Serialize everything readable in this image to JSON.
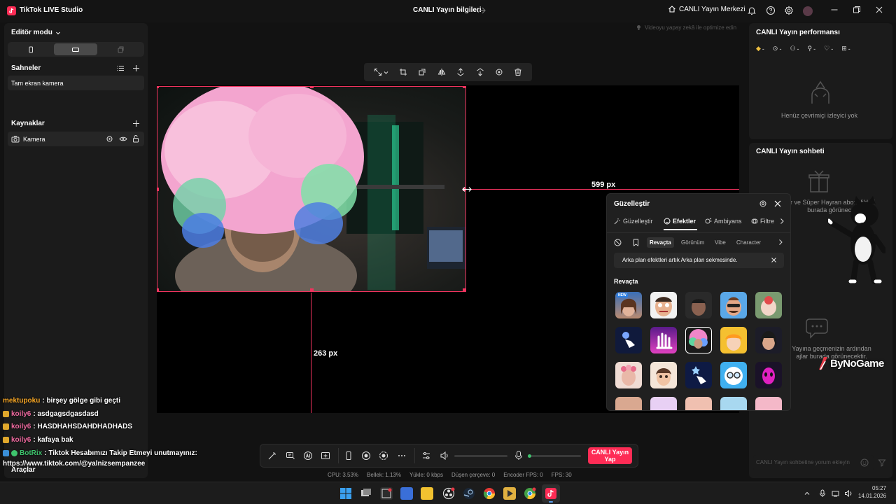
{
  "titlebar": {
    "app_title": "TikTok LIVE Studio",
    "center_title": "CANLI Yayın bilgileri",
    "live_center": "CANLI Yayın Merkezi"
  },
  "left": {
    "editor_mode": "Editör modu",
    "scenes_title": "Sahneler",
    "scene_item": "Tam ekran kamera",
    "sources_title": "Kaynaklar",
    "source_item": "Kamera",
    "tools": "Araçlar"
  },
  "chat_overlay": [
    {
      "user": "mektupoku",
      "text": ": birşey gölge gibi geçti"
    },
    {
      "user": "koily6",
      "text": ": asdgagsdgasdasd"
    },
    {
      "user": "koily6",
      "text": ": HASDHAHSDAHDHADHADS"
    },
    {
      "user": "koily6",
      "text": ": kafaya bak"
    },
    {
      "user": "BotRix",
      "text": ": Tiktok Hesabımızı Takip Etmeyi unutmayınız:"
    }
  ],
  "chat_link": "https://www.tiktok.com/@yalnizsempanzee",
  "canvas": {
    "optimize_hint": "Videoyu yapay zekâ ile optimize edin",
    "measure_right": "599 px",
    "measure_bottom": "263 px"
  },
  "bottom": {
    "go_live": "CANLI Yayın Yap",
    "stats": [
      "CPU: 3.53%",
      "Bellek: 1.13%",
      "Yükle: 0 kbps",
      "Düşen çerçeve: 0",
      "Encoder FPS: 0",
      "FPS: 30"
    ]
  },
  "right": {
    "performance_title": "CANLI Yayın performansı",
    "no_viewers": "Henüz çevrimiçi izleyici yok",
    "chat_title": "CANLI Yayın sohbeti",
    "subs_text_1": "r ve Süper Hayran abonelikleri",
    "subs_text_2": "burada görünecek",
    "past_text_1": "Yayına geçmenizin ardından",
    "past_text_2": "ajlar burada görünecektir.",
    "comment_placeholder": "CANLI Yayın sohbetine yorum ekleyin",
    "watermark": "ByNoGame"
  },
  "effects": {
    "title": "Güzelleştir",
    "tabs": [
      "Güzelleştir",
      "Efektler",
      "Ambiyans",
      "Filtre"
    ],
    "subtabs": [
      "Revaçta",
      "Görünüm",
      "Vibe",
      "Character"
    ],
    "notice": "Arka plan efektleri artık Arka plan sekmesinde.",
    "section": "Revaçta",
    "new_badge": "NEW"
  },
  "taskbar": {
    "time": "05:27",
    "date": "14.01.2026"
  },
  "colors": {
    "accent": "#fe2c55",
    "selection": "#f0335e"
  }
}
